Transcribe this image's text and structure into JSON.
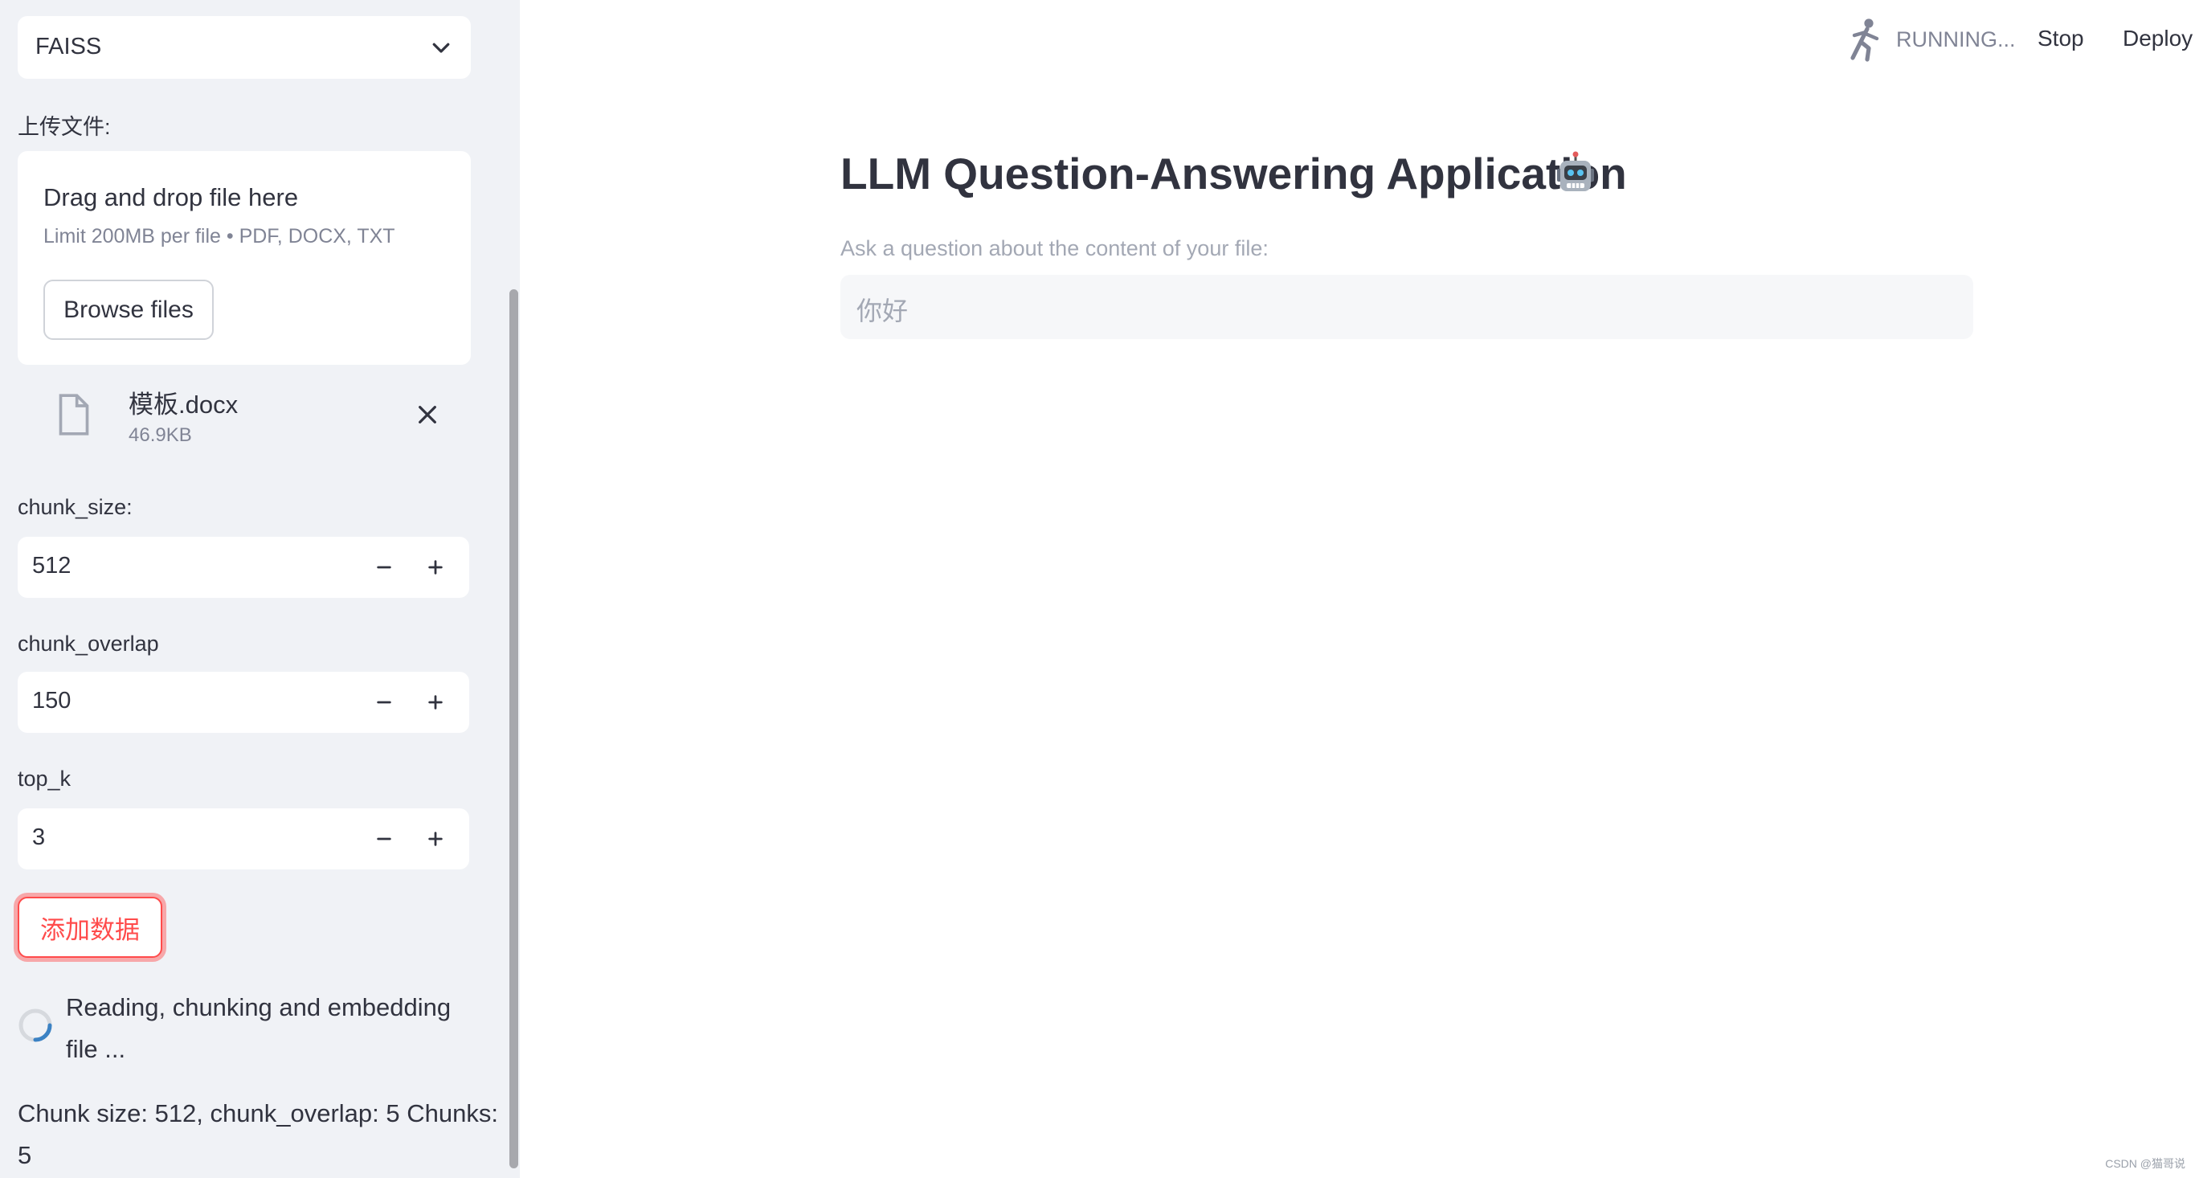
{
  "sidebar": {
    "vector_store_select": "FAISS",
    "upload_label": "上传文件:",
    "uploader": {
      "title": "Drag and drop file here",
      "limit": "Limit 200MB per file • PDF, DOCX, TXT",
      "browse_label": "Browse files"
    },
    "uploaded_file": {
      "name": "模板.docx",
      "size": "46.9KB"
    },
    "chunk_size": {
      "label": "chunk_size:",
      "value": "512"
    },
    "chunk_overlap": {
      "label": "chunk_overlap",
      "value": "150"
    },
    "top_k": {
      "label": "top_k",
      "value": "3"
    },
    "add_data_label": "添加数据",
    "status_text": "Reading, chunking and embedding file ...",
    "chunk_info": "Chunk size: 512, chunk_overlap: 5 Chunks: 5"
  },
  "header": {
    "status": "RUNNING...",
    "stop_label": "Stop",
    "deploy_label": "Deploy"
  },
  "main": {
    "title": "LLM Question-Answering Application",
    "question_label": "Ask a question about the content of your file:",
    "question_value": "你好"
  },
  "watermark": "CSDN @猫哥说",
  "colors": {
    "accent": "#ff4b4b",
    "sidebar_bg": "#f0f2f6",
    "text": "#31333f",
    "muted": "#808495"
  }
}
